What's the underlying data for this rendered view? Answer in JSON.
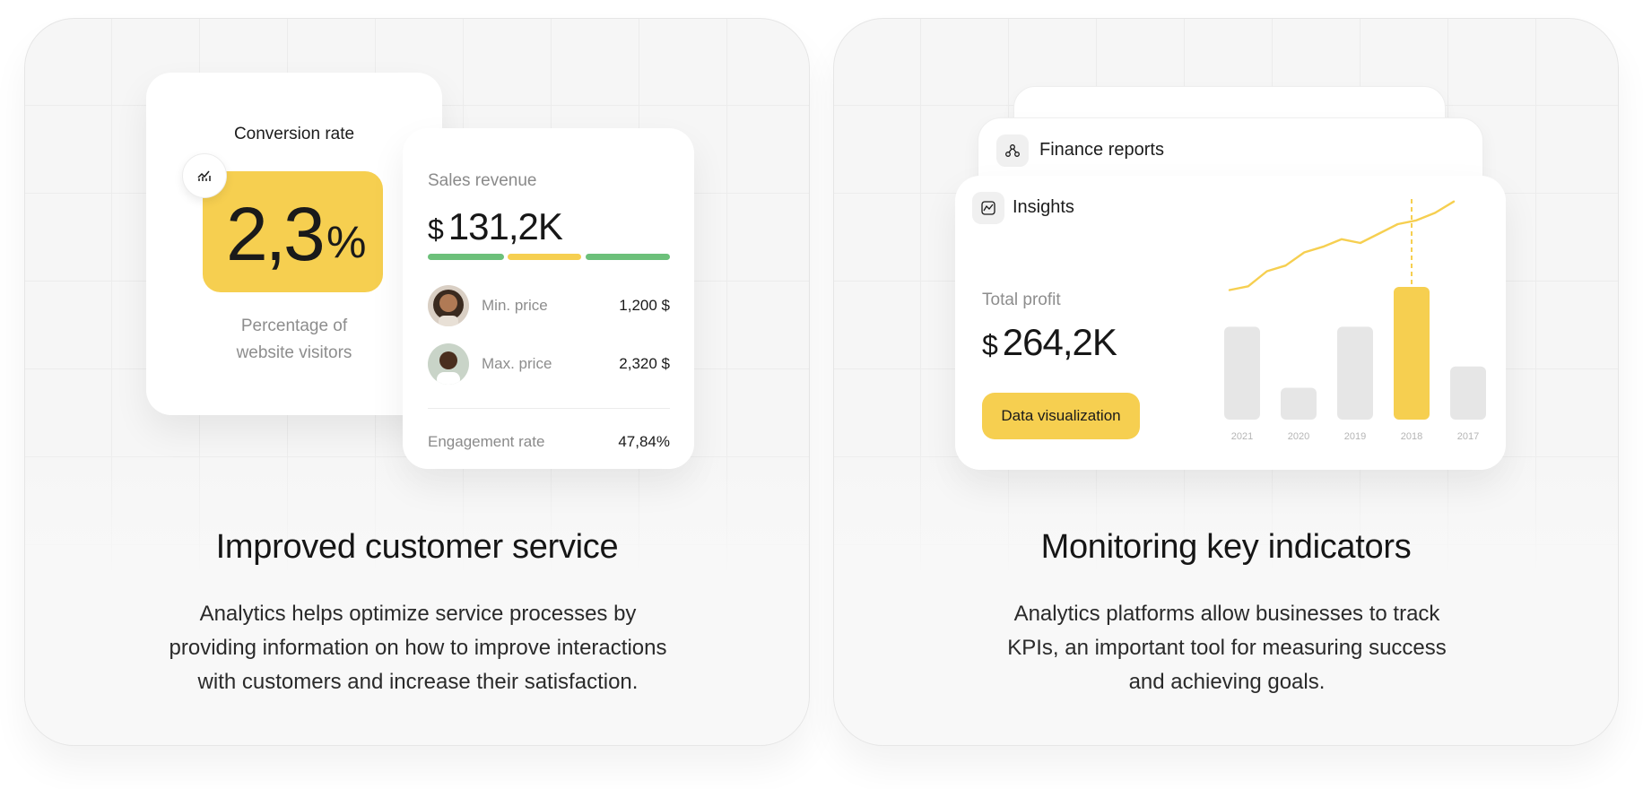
{
  "left_panel": {
    "conversion_card": {
      "title": "Conversion rate",
      "value": "2,3",
      "unit": "%",
      "subtitle_line1": "Percentage of",
      "subtitle_line2": "website visitors",
      "icon": "chart-trend-icon"
    },
    "sales_card": {
      "label": "Sales revenue",
      "currency": "$",
      "amount": "131,2K",
      "progress_segments": [
        {
          "color": "#6cc07a",
          "fraction": 0.33
        },
        {
          "color": "#f6cf50",
          "fraction": 0.32
        },
        {
          "color": "#6cc07a",
          "fraction": 0.35
        }
      ],
      "rows": [
        {
          "label": "Min. price",
          "value": "1,200 $",
          "avatar": "woman-avatar"
        },
        {
          "label": "Max. price",
          "value": "2,320 $",
          "avatar": "man-avatar"
        }
      ],
      "engagement_label": "Engagement rate",
      "engagement_value": "47,84%"
    },
    "heading": "Improved customer service",
    "body_line1": "Analytics helps optimize service processes by",
    "body_line2": "providing information on how to improve interactions",
    "body_line3": "with customers and increase their satisfaction."
  },
  "right_panel": {
    "finance_card": {
      "title": "Finance reports",
      "icon": "network-nodes-icon"
    },
    "insights_card": {
      "title": "Insights",
      "icon": "insights-chart-icon",
      "profit_label": "Total profit",
      "currency": "$",
      "profit_value": "264,2K",
      "button_label": "Data visualization"
    },
    "heading": "Monitoring key indicators",
    "body_line1": "Analytics platforms allow businesses to track",
    "body_line2": "KPIs, an important tool for measuring success",
    "body_line3": "and achieving goals."
  },
  "colors": {
    "accent_yellow": "#f6cf50",
    "accent_green": "#6cc07a",
    "bar_gray": "#e6e6e6"
  },
  "chart_data": {
    "type": "bar",
    "categories": [
      "2021",
      "2020",
      "2019",
      "2018",
      "2017"
    ],
    "values": [
      70,
      24,
      70,
      100,
      40
    ],
    "highlight_index": 3,
    "overlay_line": [
      10,
      14,
      30,
      36,
      50,
      56,
      64,
      60,
      70,
      80,
      84,
      92,
      104
    ],
    "ylim": [
      0,
      100
    ],
    "grid": false,
    "title": "",
    "xlabel": "",
    "ylabel": ""
  }
}
